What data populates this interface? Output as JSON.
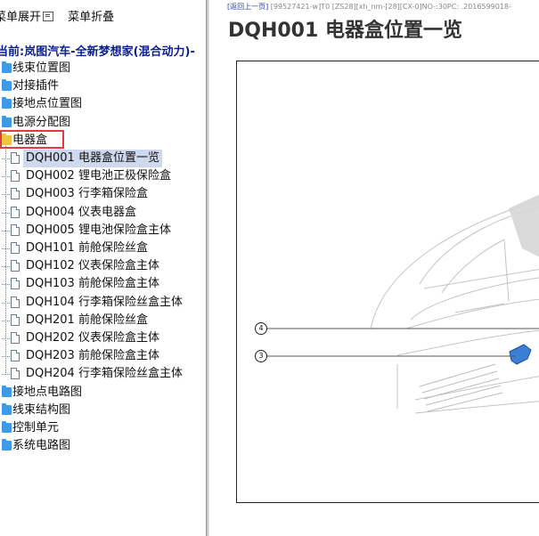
{
  "menubar": {
    "expand_label": "菜单展开",
    "collapse_label": "菜单折叠"
  },
  "tree": {
    "current_label": "当前:岚图汽车-全新梦想家(混合动力)-",
    "items": [
      {
        "label": "线束位置图"
      },
      {
        "label": "对接插件"
      },
      {
        "label": "接地点位置图"
      },
      {
        "label": "电源分配图"
      },
      {
        "label": "电器盒",
        "open": true,
        "children": [
          {
            "label": "DQH001 电器盒位置一览",
            "selected": true
          },
          {
            "label": "DQH002 锂电池正极保险盒"
          },
          {
            "label": "DQH003 行李箱保险盒"
          },
          {
            "label": "DQH004 仪表电器盒"
          },
          {
            "label": "DQH005 锂电池保险盒主体"
          },
          {
            "label": "DQH101 前舱保险丝盒"
          },
          {
            "label": "DQH102 仪表保险盒主体"
          },
          {
            "label": "DQH103 前舱保险盒主体"
          },
          {
            "label": "DQH104 行李箱保险丝盒主体"
          },
          {
            "label": "DQH201 前舱保险丝盒"
          },
          {
            "label": "DQH202 仪表保险盒主体"
          },
          {
            "label": "DQH203 前舱保险盒主体"
          },
          {
            "label": "DQH204 行李箱保险丝盒主体"
          }
        ]
      },
      {
        "label": "接地点电路图"
      },
      {
        "label": "线束结构图"
      },
      {
        "label": "控制单元"
      },
      {
        "label": "系统电路图"
      }
    ]
  },
  "content": {
    "back_link": "[返回上一页]",
    "breadcrumb_rest": " [99527421-w]T0 [ZS28][xh_nm-[28][CX-0]NO-:30PC: .2016599018-",
    "title": "DQH001 电器盒位置一览",
    "callouts": [
      "4",
      "3"
    ],
    "colors": {
      "selected_bg": "#cfd9ee",
      "folder": "#3d9ae8",
      "open_folder": "#f0c341",
      "highlight": "#e13c3c",
      "current_text": "#0a1f8f",
      "part": "#3a7fd6"
    }
  }
}
